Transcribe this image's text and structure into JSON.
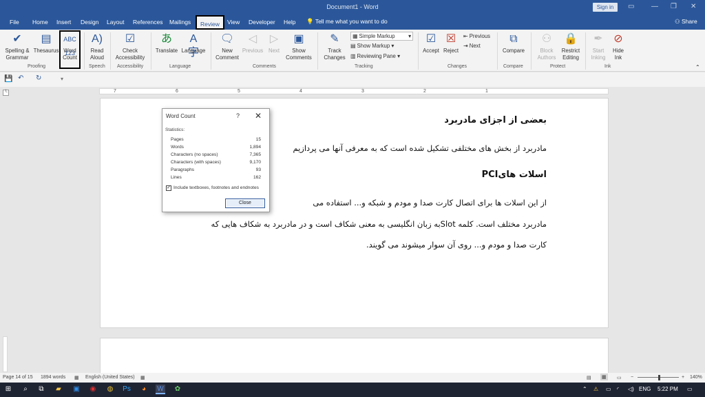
{
  "window": {
    "title": "Document1 - Word",
    "signin": "Sign in"
  },
  "tabs": [
    "File",
    "Home",
    "Insert",
    "Design",
    "Layout",
    "References",
    "Mailings",
    "Review",
    "View",
    "Developer",
    "Help"
  ],
  "tell_me": "Tell me what you want to do",
  "share": "Share",
  "ribbon": {
    "spelling": "Spelling &\nGrammar",
    "thesaurus": "Thesaurus",
    "word_count": "Word\nCount",
    "read_aloud": "Read\nAloud",
    "check_accessibility": "Check\nAccessibility",
    "translate": "Translate",
    "language": "Language",
    "new_comment": "New\nComment",
    "previous": "Previous",
    "next": "Next",
    "show_comments": "Show\nComments",
    "track_changes": "Track\nChanges",
    "simple_markup": "Simple Markup",
    "show_markup": "Show Markup",
    "reviewing_pane": "Reviewing Pane",
    "accept": "Accept",
    "reject": "Reject",
    "prev_change": "Previous",
    "next_change": "Next",
    "compare": "Compare",
    "block_authors": "Block\nAuthors",
    "restrict_editing": "Restrict\nEditing",
    "start_inking": "Start\nInking",
    "hide_ink": "Hide\nInk",
    "groups": [
      "Proofing",
      "Speech",
      "Accessibility",
      "Language",
      "Comments",
      "Tracking",
      "Changes",
      "Compare",
      "Protect",
      "Ink"
    ]
  },
  "ruler_ticks": [
    "7",
    "6",
    "5",
    "4",
    "3",
    "2",
    "1"
  ],
  "document": {
    "heading1": "بعضی از اجزای مادربرد",
    "para1": "مادربرد از بخش های مختلفی تشکیل شده است که به معرفی آنها می پردازیم",
    "heading2": "اسلات هایPCI",
    "para2_line1": "از این اسلات ها برای اتصال کارت صدا و مودم و شبکه و... استفاده می",
    "para2_line2": "مادربرد مختلف است. کلمه Slotبه زبان انگلیسی به معنی شکاف است و در مادربرد به شکاف هایی که",
    "para2_line3": "کارت صدا و مودم و... روی آن سوار میشوند می گویند."
  },
  "dialog": {
    "title": "Word Count",
    "help": "?",
    "close_x": "✕",
    "statistics": "Statistics:",
    "rows": [
      {
        "label": "Pages",
        "value": "15"
      },
      {
        "label": "Words",
        "value": "1,894"
      },
      {
        "label": "Characters (no spaces)",
        "value": "7,365"
      },
      {
        "label": "Characters (with spaces)",
        "value": "9,170"
      },
      {
        "label": "Paragraphs",
        "value": "93"
      },
      {
        "label": "Lines",
        "value": "162"
      }
    ],
    "checkbox_label": "Include textboxes, footnotes and endnotes",
    "close_button": "Close"
  },
  "status": {
    "page": "Page 14 of 15",
    "words": "1894 words",
    "language": "English (United States)",
    "zoom": "140%"
  },
  "tray": {
    "lang": "ENG",
    "time": "5:22 PM"
  }
}
